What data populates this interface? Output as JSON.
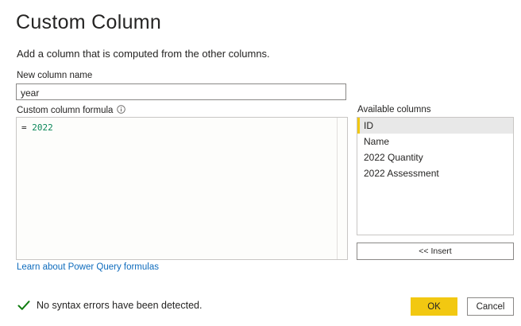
{
  "dialog": {
    "title": "Custom Column",
    "subtitle": "Add a column that is computed from the other columns."
  },
  "new_column": {
    "label": "New column name",
    "value": "year"
  },
  "formula": {
    "label": "Custom column formula",
    "info_icon": "info-icon",
    "operator": "= ",
    "value": "2022"
  },
  "available_columns": {
    "label": "Available columns",
    "items": [
      {
        "label": "ID",
        "selected": true
      },
      {
        "label": "Name",
        "selected": false
      },
      {
        "label": "2022 Quantity",
        "selected": false
      },
      {
        "label": "2022 Assessment",
        "selected": false
      }
    ],
    "insert_label": "<< Insert"
  },
  "learn_link": "Learn about Power Query formulas",
  "status": {
    "icon": "checkmark-icon",
    "text": "No syntax errors have been detected."
  },
  "buttons": {
    "ok_label": "OK",
    "cancel_label": "Cancel"
  },
  "colors": {
    "accent": "#f2c811",
    "link": "#0f6cbd",
    "success": "#107c10",
    "formula_number": "#098658"
  }
}
